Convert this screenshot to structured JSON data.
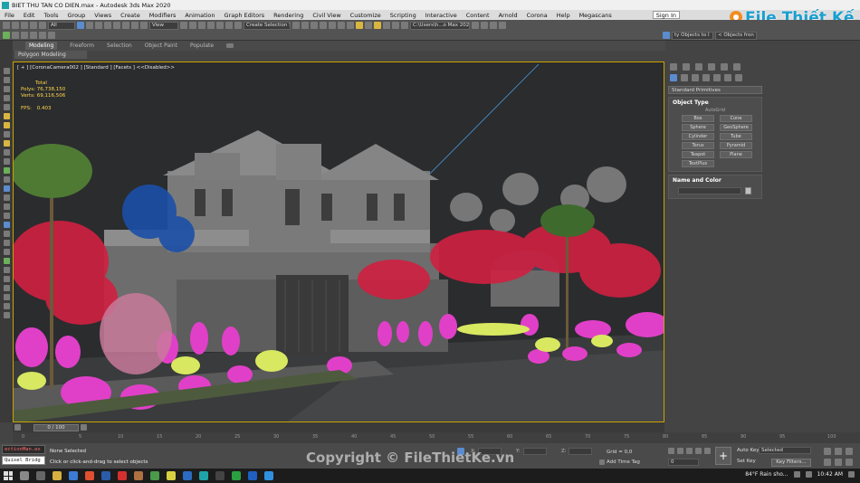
{
  "window": {
    "title": "BIET THU TAN CO DIEN.max - Autodesk 3ds Max 2020"
  },
  "menu": {
    "items": [
      "File",
      "Edit",
      "Tools",
      "Group",
      "Views",
      "Create",
      "Modifiers",
      "Animation",
      "Graph Editors",
      "Rendering",
      "Civil View",
      "Customize",
      "Scripting",
      "Interactive",
      "Content",
      "Arnold",
      "Corona",
      "Help",
      "Megascans"
    ],
    "sign_in": "Sign In"
  },
  "toolbar": {
    "filter": "All",
    "view": "View",
    "selection_set": "Create Selection Se",
    "path": "C:\\Users\\h...o Max 2020",
    "objects_to": "ty Objects to I",
    "objects_from": "< Objects fron"
  },
  "ribbon": {
    "tabs": [
      "Modeling",
      "Freeform",
      "Selection",
      "Object Paint",
      "Populate"
    ],
    "active": "Modeling",
    "sub": "Polygon Modeling"
  },
  "viewport": {
    "label": "[ + ] [CoronaCamera002 ] [Standard ] [Facets ] <<Disabled>>",
    "stats": {
      "total_label": "Total",
      "polys_label": "Polys:",
      "polys": "76,738,150",
      "verts_label": "Verts:",
      "verts": "69,116,506",
      "fps_label": "FPS:",
      "fps": "0.403"
    }
  },
  "command_panel": {
    "category": "Standard Primitives",
    "object_type_title": "Object Type",
    "autogrid": "AutoGrid",
    "primitives": [
      "Box",
      "Cone",
      "Sphere",
      "GeoSphere",
      "Cylinder",
      "Tube",
      "Torus",
      "Pyramid",
      "Teapot",
      "Plane",
      "TextPlus"
    ],
    "name_color_title": "Name and Color"
  },
  "timeline": {
    "slider": "0 / 100",
    "ticks": [
      "0",
      "5",
      "10",
      "15",
      "20",
      "25",
      "30",
      "35",
      "40",
      "45",
      "50",
      "55",
      "60",
      "65",
      "70",
      "75",
      "80",
      "85",
      "90",
      "95",
      "100"
    ]
  },
  "status": {
    "maxscript_btn": "ectionMan.ex",
    "quixel_btn": "Quixel Bridg",
    "none_selected": "None Selected",
    "prompt": "Click or click-and-drag to select objects",
    "x_label": "X:",
    "y_label": "Y:",
    "z_label": "Z:",
    "grid": "Grid = 0,0",
    "add_time_tag": "Add Time Tag",
    "frame": "0",
    "auto_key": "Auto Key",
    "set_key": "Set Key",
    "selected": "Selected",
    "key_filters": "Key Filters..."
  },
  "taskbar": {
    "weather": "84°F  Rain sho...",
    "time": "10:42 AM"
  },
  "watermark": "Copyright © FileThietKe.vn",
  "logo": "File Thiết Kế.vn",
  "colors": {
    "accent": "#1a9fd0",
    "stats": "#ffd84a",
    "viewport_border": "#c8a400"
  }
}
